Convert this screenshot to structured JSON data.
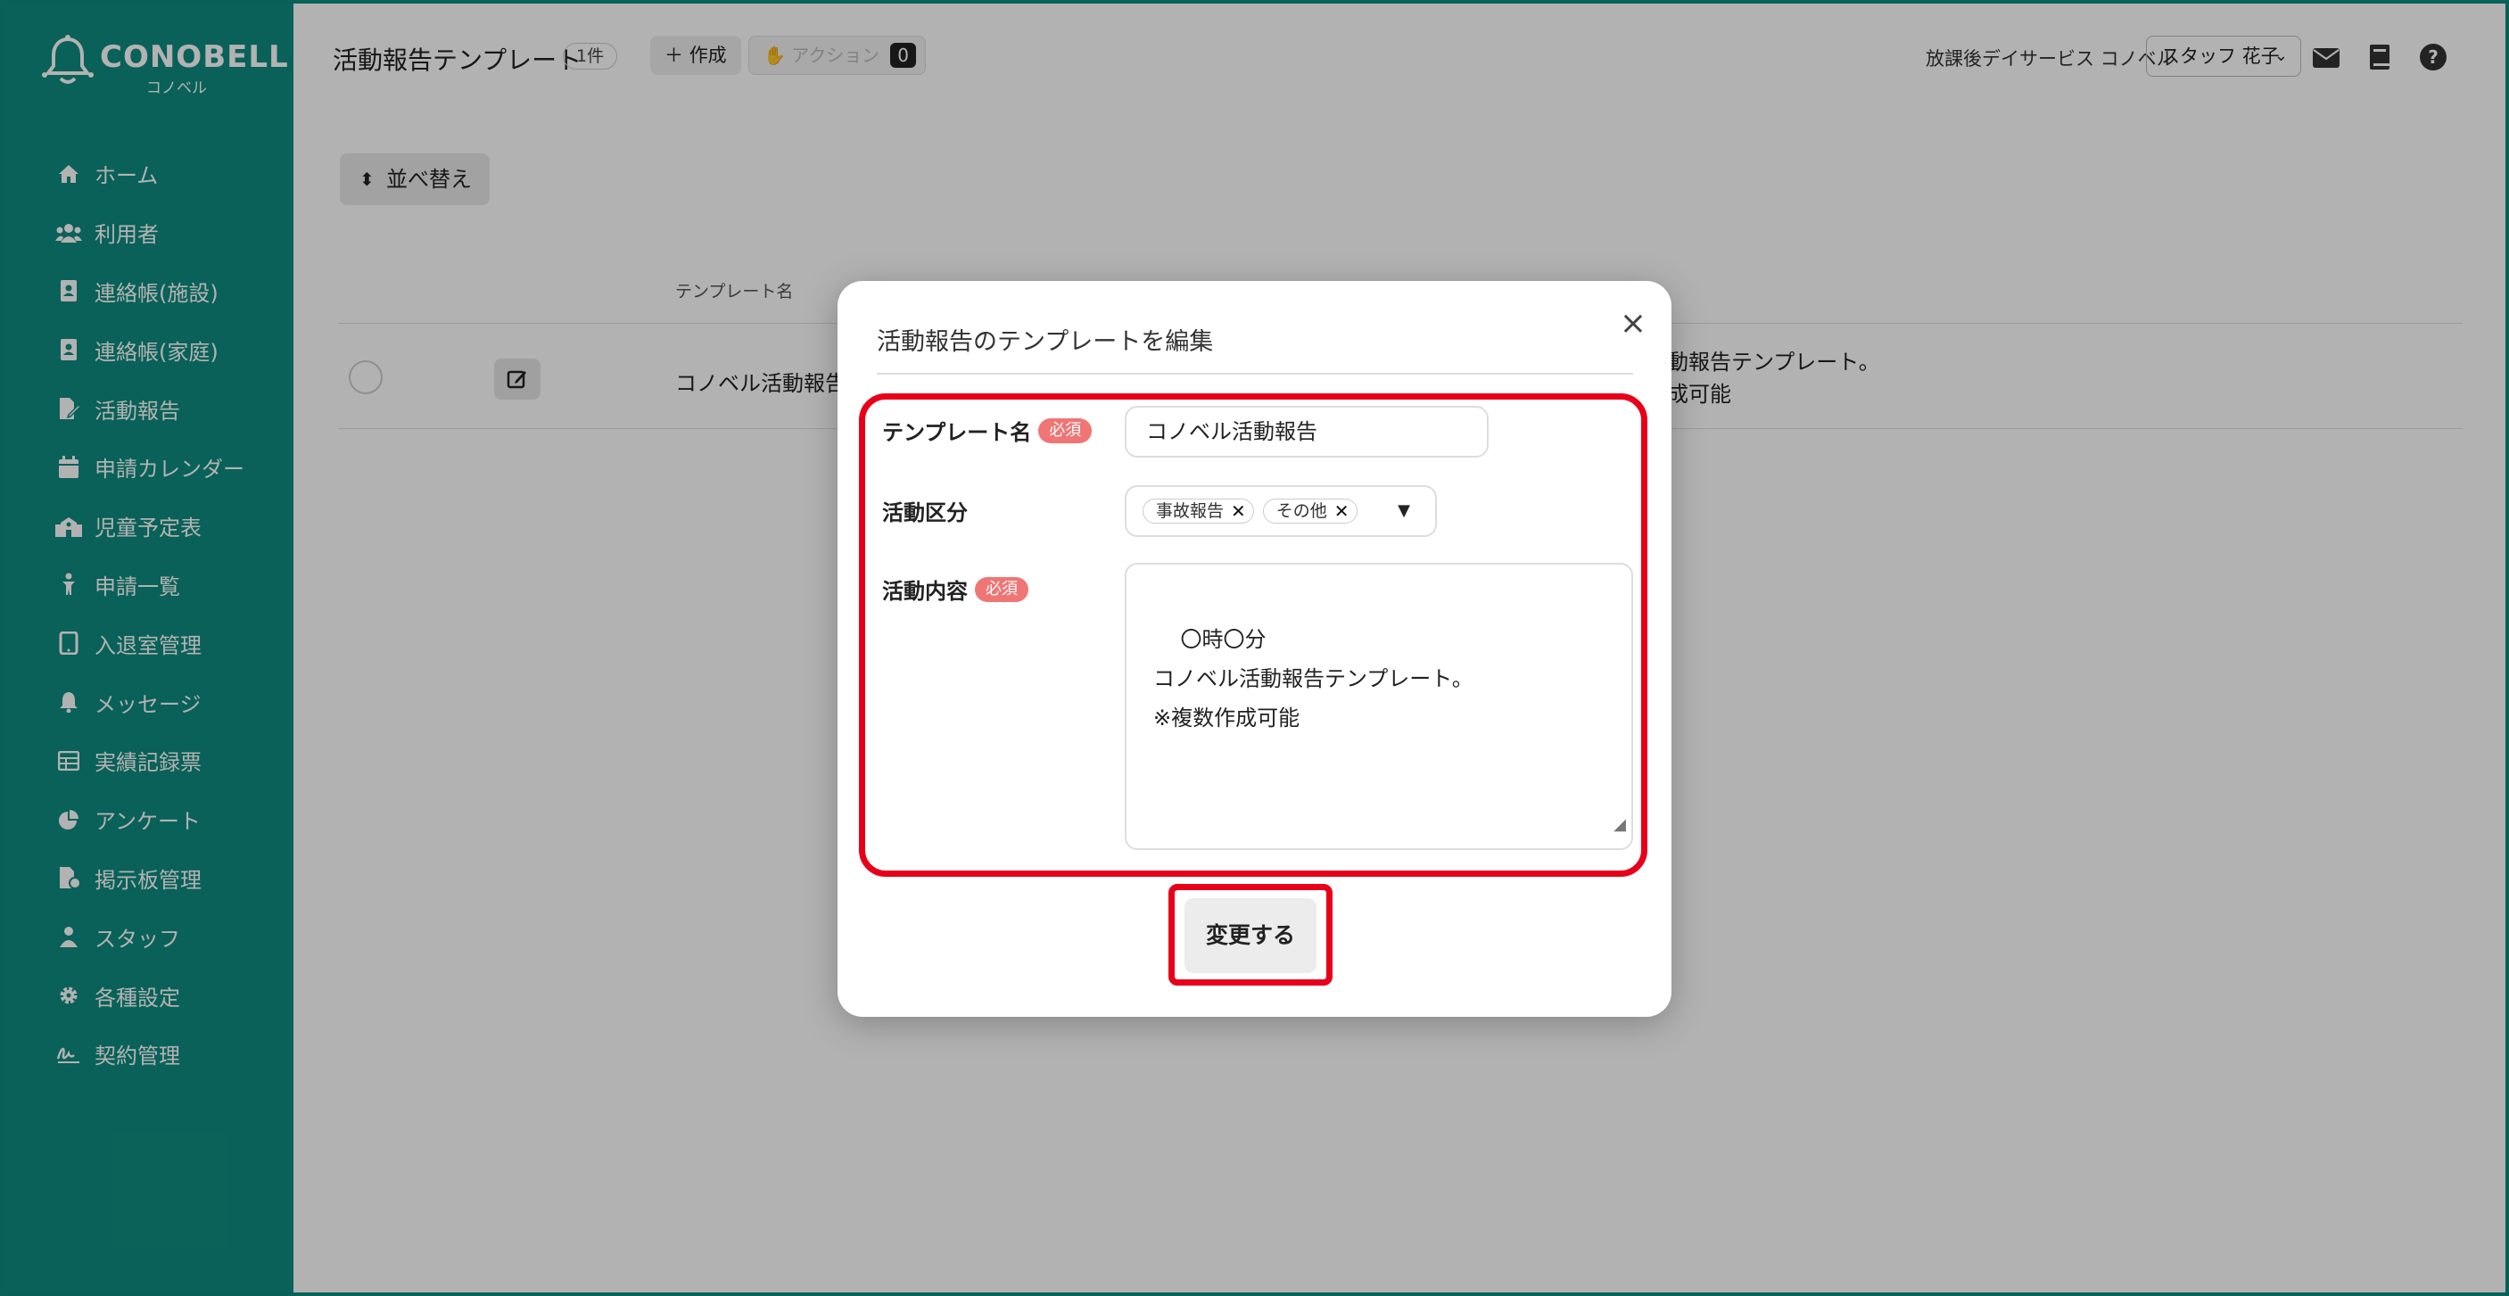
{
  "brand": {
    "name": "CONOBELL",
    "subname": "コノベル"
  },
  "sidebar": {
    "items": [
      {
        "label": "ホーム",
        "icon": "home-icon"
      },
      {
        "label": "利用者",
        "icon": "users-icon"
      },
      {
        "label": "連絡帳(施設)",
        "icon": "contact-book-icon"
      },
      {
        "label": "連絡帳(家庭)",
        "icon": "contact-book-icon"
      },
      {
        "label": "活動報告",
        "icon": "report-icon"
      },
      {
        "label": "申請カレンダー",
        "icon": "calendar-icon"
      },
      {
        "label": "児童予定表",
        "icon": "school-icon"
      },
      {
        "label": "申請一覧",
        "icon": "person-icon"
      },
      {
        "label": "入退室管理",
        "icon": "tablet-icon"
      },
      {
        "label": "メッセージ",
        "icon": "bell-icon"
      },
      {
        "label": "実績記録票",
        "icon": "table-icon"
      },
      {
        "label": "アンケート",
        "icon": "pie-chart-icon"
      },
      {
        "label": "掲示板管理",
        "icon": "board-icon"
      },
      {
        "label": "スタッフ",
        "icon": "staff-icon"
      },
      {
        "label": "各種設定",
        "icon": "gear-icon"
      },
      {
        "label": "契約管理",
        "icon": "signature-icon"
      }
    ]
  },
  "header": {
    "title": "活動報告テンプレート",
    "count": "1件",
    "create_label": "作成",
    "action_label": "アクション",
    "action_count": "0",
    "facility": "放課後デイサービス コノベル",
    "staff": "スタッフ 花子"
  },
  "list": {
    "sort_label": "並べ替え",
    "column_name": "テンプレート名",
    "row_name": "コノベル活動報告",
    "row_content": "動報告テンプレート。\n成可能"
  },
  "modal": {
    "title": "活動報告のテンプレートを編集",
    "name_label": "テンプレート名",
    "required": "必須",
    "name_value": "コノベル活動報告",
    "category_label": "活動区分",
    "categories": [
      "事故報告",
      "その他"
    ],
    "content_label": "活動内容",
    "content_value": "〇時〇分\nコノベル活動報告テンプレート。\n※複数作成可能",
    "submit_label": "変更する"
  },
  "colors": {
    "brand": "#0e8c80",
    "highlight": "#e8001a",
    "required": "#f07575"
  }
}
